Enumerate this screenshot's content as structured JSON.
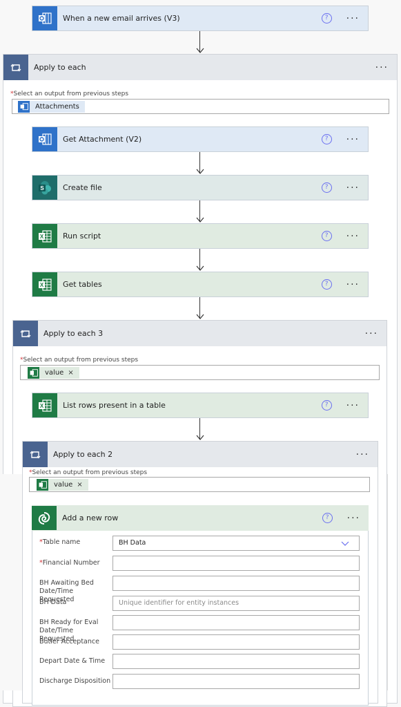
{
  "colors": {
    "outlook_blue": "#2f72c9",
    "sharepoint_teal": "#1f6d6a",
    "excel_green": "#1f7b45",
    "loop_header": "#4a6490",
    "required_red": "#d13438",
    "help_purple": "#6a6ff0"
  },
  "trigger": {
    "title": "When a new email arrives (V3)",
    "icon": "outlook-icon",
    "help": "?",
    "more": "···"
  },
  "loop1": {
    "title": "Apply to each",
    "icon": "loop-icon",
    "more": "···",
    "select_label": "Select an output from previous steps",
    "required_mark": "*",
    "token": {
      "label": "Attachments",
      "icon": "outlook-icon"
    },
    "steps": [
      {
        "title": "Get Attachment (V2)",
        "icon": "outlook-icon",
        "help": "?",
        "more": "···"
      },
      {
        "title": "Create file",
        "icon": "sharepoint-icon",
        "help": "?",
        "more": "···"
      },
      {
        "title": "Run script",
        "icon": "excel-icon",
        "help": "?",
        "more": "···"
      },
      {
        "title": "Get tables",
        "icon": "excel-icon",
        "help": "?",
        "more": "···"
      }
    ]
  },
  "loop3": {
    "title": "Apply to each 3",
    "icon": "loop-icon",
    "more": "···",
    "select_label": "Select an output from previous steps",
    "required_mark": "*",
    "token": {
      "label": "value",
      "remove": "×",
      "icon": "excel-icon"
    },
    "steps": [
      {
        "title": "List rows present in a table",
        "icon": "excel-icon",
        "help": "?",
        "more": "···"
      }
    ]
  },
  "loop2": {
    "title": "Apply to each 2",
    "icon": "loop-icon",
    "more": "···",
    "select_label": "Select an output from previous steps",
    "required_mark": "*",
    "token": {
      "label": "value",
      "remove": "×",
      "icon": "excel-icon"
    },
    "action": {
      "title": "Add a new row",
      "icon": "dataverse-icon",
      "help": "?",
      "more": "···",
      "fields": [
        {
          "label": "Table name",
          "required": true,
          "value": "BH Data",
          "type": "dropdown"
        },
        {
          "label": "Financial Number",
          "required": true,
          "value": ""
        },
        {
          "label": "BH Awaiting Bed Date/Time Requested",
          "required": false,
          "value": ""
        },
        {
          "label": "BH Data",
          "required": false,
          "value": "",
          "placeholder": "Unique identifier for entity instances"
        },
        {
          "label": "BH Ready for Eval Date/Time Requested",
          "required": false,
          "value": ""
        },
        {
          "label": "Butler Acceptance",
          "required": false,
          "value": ""
        },
        {
          "label": "Depart Date & Time",
          "required": false,
          "value": ""
        },
        {
          "label": "Discharge Disposition",
          "required": false,
          "value": ""
        }
      ]
    }
  }
}
